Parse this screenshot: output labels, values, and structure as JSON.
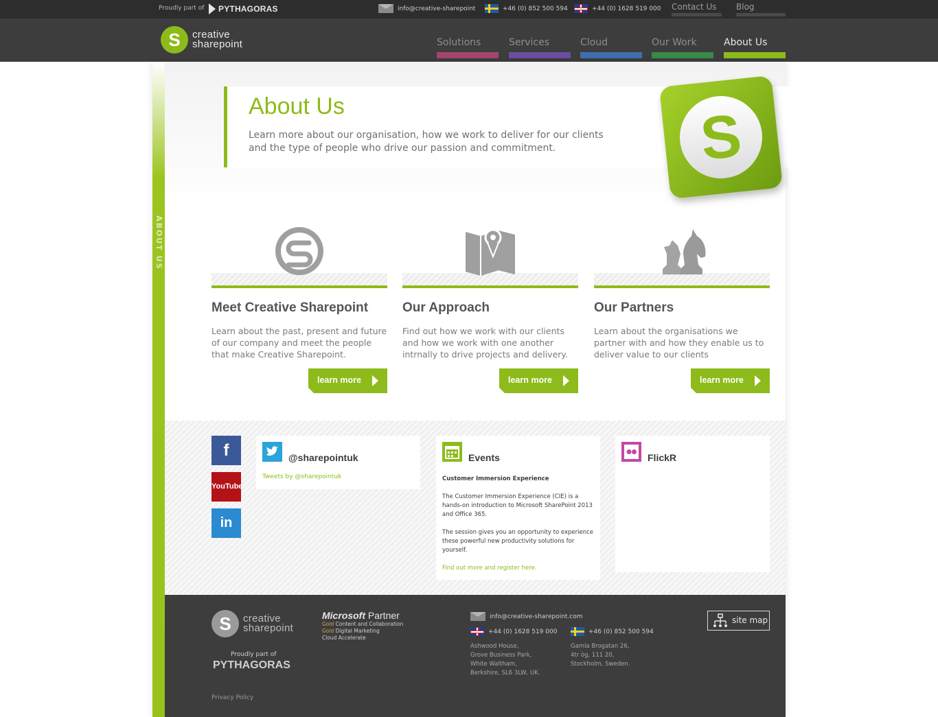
{
  "topbar": {
    "proudly": "Proudly part of",
    "pythagoras": "PYTHAGORAS",
    "email": "info@creative-sharepoint",
    "phone_se": "+46 (0) 852 500 594",
    "phone_uk": "+44 (0) 1628 519 000",
    "links": [
      {
        "label": "Contact Us"
      },
      {
        "label": "Blog"
      }
    ]
  },
  "header": {
    "logo_line1": "creative",
    "logo_line2": "sharepoint",
    "nav": [
      {
        "label": "Solutions",
        "color": "#a3456f"
      },
      {
        "label": "Services",
        "color": "#6b4ea0"
      },
      {
        "label": "Cloud",
        "color": "#3e6fb0"
      },
      {
        "label": "Our Work",
        "color": "#3a8a4a"
      },
      {
        "label": "About Us",
        "color": "#8dbb1b",
        "active": true
      }
    ]
  },
  "sidebar": {
    "label": "ABOUT US"
  },
  "hero": {
    "title": "About Us",
    "subtitle": "Learn more about our organisation, how we work to deliver for our clients and the type of people who drive our passion and commitment."
  },
  "features": [
    {
      "title": "Meet Creative Sharepoint",
      "text": "Learn about the past, present and future of our company and meet the people that make Creative Sharepoint.",
      "button": "learn more",
      "icon": "sharepoint-logo-icon"
    },
    {
      "title": "Our Approach",
      "text": "Find out how we work with our clients and how we work with one another intrnally to drive projects and delivery.",
      "button": "learn more",
      "icon": "map-icon"
    },
    {
      "title": "Our Partners",
      "text": "Learn about the organisations we partner with and how they enable us to deliver value to our clients",
      "button": "learn more",
      "icon": "chess-icon"
    }
  ],
  "social": {
    "facebook": "f",
    "youtube": "YouTube",
    "linkedin": "in",
    "twitter": {
      "title": "@sharepointuk",
      "link": "Tweets by @sharepointuk"
    },
    "events": {
      "title": "Events",
      "heading": "Customer Immersion Experience",
      "para1": "The Customer Immersion Experience (CIE) is a hands-on introduction to Microsoft SharePoint 2013 and Office 365.",
      "para2": "The session gives you an opportunity to experience these powerful new productivity solutions for yourself.",
      "link": "Find out more and register here."
    },
    "flickr": {
      "title": "FlickR"
    }
  },
  "footer": {
    "logo_line1": "creative",
    "logo_line2": "sharepoint",
    "proudly": "Proudly part of",
    "pythagoras": "PYTHAGORAS",
    "ms_brand": "Microsoft",
    "ms_partner": "Partner",
    "ms_gold1": "Gold",
    "ms_comp1": "Content and Collaboration",
    "ms_gold2": "Gold",
    "ms_comp2": "Digital Marketing",
    "ms_comp3": "Cloud Accelerate",
    "email": "info@creative-sharepoint.com",
    "phone_uk": "+44 (0) 1628 519 000",
    "phone_se": "+46 (0) 852 500 594",
    "addr_uk": [
      "Ashwood House,",
      "Grove Business Park,",
      "White Waltham,",
      "Berkshire, SL6 3LW, UK."
    ],
    "addr_se": [
      "Gamla Brogatan 26,",
      "4tr òg, 111 20,",
      "Stockholm, Sweden."
    ],
    "sitemap": "site map",
    "privacy": "Privacy Policy"
  }
}
